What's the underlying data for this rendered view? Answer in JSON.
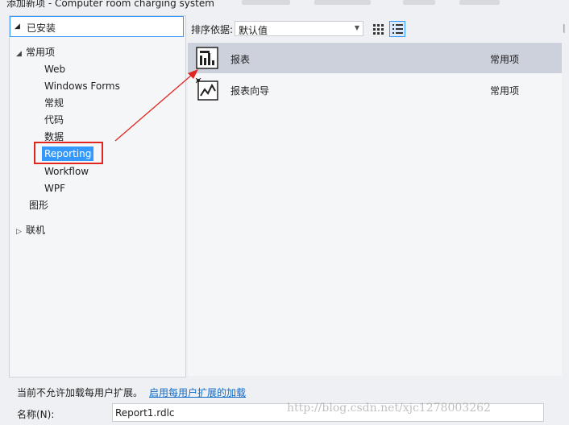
{
  "window": {
    "title": "添加新项 - Computer room charging system"
  },
  "tree": {
    "installed": "已安装",
    "common": "常用项",
    "children": [
      "Web",
      "Windows Forms",
      "常规",
      "代码",
      "数据",
      "Reporting",
      "Workflow",
      "WPF"
    ],
    "graphics": "图形",
    "online": "联机"
  },
  "sort": {
    "label": "排序依据:",
    "value": "默认值"
  },
  "items": [
    {
      "name": "报表",
      "category": "常用项"
    },
    {
      "name": "报表向导",
      "category": "常用项"
    }
  ],
  "bottom": {
    "notice": "当前不允许加载每用户扩展。",
    "notice_link": "启用每用户扩展的加载",
    "name_label": "名称(N):",
    "name_value": "Report1.rdlc"
  },
  "watermark": "http://blog.csdn.net/xjc1278003262",
  "colors": {
    "selection": "#3399ff",
    "annotation": "#e0261f",
    "link": "#0e6ac8"
  }
}
